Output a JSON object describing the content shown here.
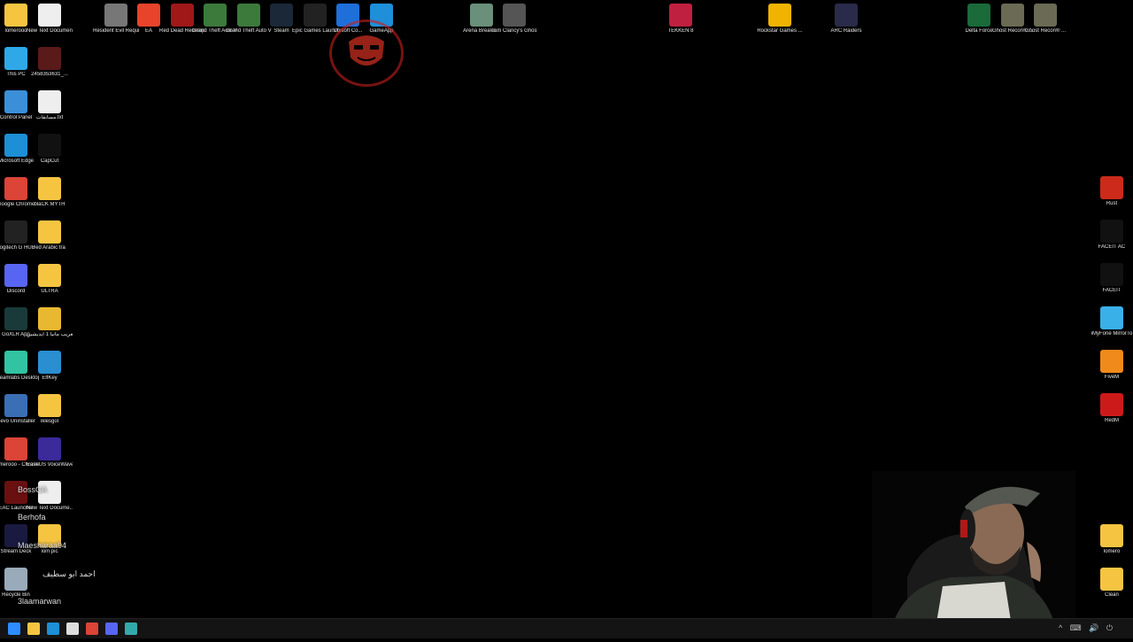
{
  "desktop": {
    "left_col1": [
      {
        "label": "lomerooo",
        "icon": "folder-icon",
        "color": "#f5c542"
      },
      {
        "label": "This PC",
        "icon": "monitor-icon",
        "color": "#2fa8e8"
      },
      {
        "label": "Control Panel",
        "icon": "control-panel-icon",
        "color": "#3b8fd8"
      },
      {
        "label": "Microsoft Edge",
        "icon": "edge-icon",
        "color": "#1c8fd6"
      },
      {
        "label": "Google Chrome",
        "icon": "chrome-icon",
        "color": "#db4437"
      },
      {
        "label": "Logitech G HUB",
        "icon": "logitech-icon",
        "color": "#222222"
      },
      {
        "label": "Discord",
        "icon": "discord-icon",
        "color": "#5865f2"
      },
      {
        "label": "GoXLR App",
        "icon": "goxlr-icon",
        "color": "#1a3a3a"
      },
      {
        "label": "Streamlabs Desktop",
        "icon": "streamlabs-icon",
        "color": "#31c3a2"
      },
      {
        "label": "Revo Uninstaller",
        "icon": "revo-icon",
        "color": "#3a6fb5"
      },
      {
        "label": "Lomerooo - Chrome",
        "icon": "chrome-icon",
        "color": "#db4437"
      },
      {
        "label": "EAC Launcher",
        "icon": "eac-icon",
        "color": "#6a1010"
      },
      {
        "label": "Stream Deck",
        "icon": "stream-deck-icon",
        "color": "#1a1a40"
      },
      {
        "label": "Recycle Bin",
        "icon": "recycle-bin-icon",
        "color": "#9ab"
      }
    ],
    "left_col2": [
      {
        "label": "New Text Document....",
        "icon": "text-file-icon",
        "color": "#eeeeee"
      },
      {
        "label": "2458353631_...",
        "icon": "image-file-icon",
        "color": "#5a1a1a"
      },
      {
        "label": "مسابقات.txt",
        "icon": "text-file-icon",
        "color": "#eeeeee"
      },
      {
        "label": "CapCut",
        "icon": "capcut-icon",
        "color": "#111111"
      },
      {
        "label": "blaCK MYTH",
        "icon": "folder-icon",
        "color": "#f5c542"
      },
      {
        "label": "red Arabic tra",
        "icon": "folder-icon",
        "color": "#f5c542"
      },
      {
        "label": "ULTRA",
        "icon": "folder-icon",
        "color": "#f5c542"
      },
      {
        "label": "تعريب مانيا 1 ايديشين",
        "icon": "folder-icon",
        "color": "#e8b830"
      },
      {
        "label": "ElfKey",
        "icon": "elfkey-icon",
        "color": "#2a8fd0"
      },
      {
        "label": "iklesgol",
        "icon": "folder-icon",
        "color": "#f5c542"
      },
      {
        "label": "EaseUS VoiceWave",
        "icon": "voicewave-icon",
        "color": "#3a2a9a"
      },
      {
        "label": "New Text Docume...",
        "icon": "text-file-icon",
        "color": "#eeeeee"
      },
      {
        "label": "lom pic",
        "icon": "folder-icon",
        "color": "#f5c542"
      }
    ],
    "top_row": [
      {
        "label": "Resident Evil Requiem",
        "icon": "re-icon",
        "color": "#777777"
      },
      {
        "label": "EA",
        "icon": "ea-icon",
        "color": "#e8432b"
      },
      {
        "label": "Red Dead Redempti...",
        "icon": "rdr-icon",
        "color": "#a01818"
      },
      {
        "label": "Grand Theft Auto V Le...",
        "icon": "gta-icon",
        "color": "#3c7a3c"
      },
      {
        "label": "Grand Theft Auto V",
        "icon": "gta-icon",
        "color": "#3c7a3c"
      },
      {
        "label": "Steam",
        "icon": "steam-icon",
        "color": "#1b2838"
      },
      {
        "label": "Epic Games Launcher",
        "icon": "epic-icon",
        "color": "#222222"
      },
      {
        "label": "Ubisoft Co...",
        "icon": "ubisoft-icon",
        "color": "#1e6fd9"
      },
      {
        "label": "GameApp",
        "icon": "gameapp-icon",
        "color": "#1e8fd9"
      },
      {
        "label": "Arena Breako...",
        "icon": "arena-icon",
        "color": "#6a8f7a"
      },
      {
        "label": "Tom Clancy's Ghost Reco...",
        "icon": "ghost-recon-icon",
        "color": "#555555"
      },
      {
        "label": "TEKKEN 8",
        "icon": "tekken-icon",
        "color": "#c02040"
      },
      {
        "label": "Rockstar Games ...",
        "icon": "rockstar-icon",
        "color": "#f0b400"
      },
      {
        "label": "ARC Raiders",
        "icon": "arc-raiders-icon",
        "color": "#2a2a4a"
      },
      {
        "label": "Delta Force",
        "icon": "delta-force-icon",
        "color": "#1a6a3a"
      },
      {
        "label": "Ghost Recon® ...",
        "icon": "ghost-recon-icon",
        "color": "#6a6a55"
      },
      {
        "label": "Ghost Recon® ...",
        "icon": "ghost-recon-icon",
        "color": "#6a6a55"
      }
    ],
    "right_col": [
      {
        "label": "Rust",
        "icon": "rust-icon",
        "color": "#cc2a1a"
      },
      {
        "label": "FACEIT AC",
        "icon": "faceit-ac-icon",
        "color": "#111111"
      },
      {
        "label": "FACEIT",
        "icon": "faceit-icon",
        "color": "#111111"
      },
      {
        "label": "iMyFone MirrorTo",
        "icon": "mirrorto-icon",
        "color": "#3ab0e8"
      },
      {
        "label": "FiveM",
        "icon": "fivem-icon",
        "color": "#f08a1a"
      },
      {
        "label": "RedM",
        "icon": "redm-icon",
        "color": "#cc1a1a"
      },
      {
        "label": "lomero",
        "icon": "folder-icon",
        "color": "#f5c542"
      },
      {
        "label": "Clean",
        "icon": "folder-icon",
        "color": "#f5c542"
      }
    ]
  },
  "chat_overlay": [
    {
      "name": "BossGA",
      "color": "#dddddd"
    },
    {
      "name": "Berhofa",
      "color": "#dddddd"
    },
    {
      "name": "Maesharaa94",
      "color": "#dddddd"
    },
    {
      "name": "احمد ابو سطيف",
      "color": "#dddddd"
    },
    {
      "name": "3laamarwan",
      "color": "#dddddd"
    }
  ],
  "taskbar": {
    "items": [
      {
        "icon": "windows-start-icon",
        "color": "#2d8cff"
      },
      {
        "icon": "file-explorer-icon",
        "color": "#f5c542"
      },
      {
        "icon": "edge-icon",
        "color": "#1c8fd6"
      },
      {
        "icon": "store-icon",
        "color": "#dddddd"
      },
      {
        "icon": "chrome-icon",
        "color": "#db4437"
      },
      {
        "icon": "discord-icon",
        "color": "#5865f2"
      },
      {
        "icon": "goxlr-icon",
        "color": "#3aa"
      }
    ],
    "tray_icons": "^ ⌨ 🔊 ⏻"
  }
}
